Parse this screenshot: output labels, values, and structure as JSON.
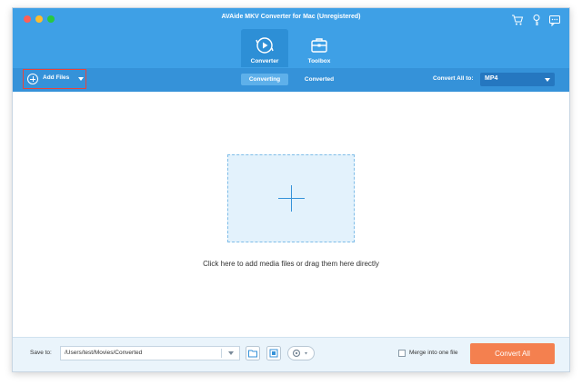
{
  "window": {
    "title": "AVAide MKV Converter for Mac (Unregistered)"
  },
  "top_icons": [
    "cart-icon",
    "key-icon",
    "chat-icon"
  ],
  "nav": {
    "tabs": [
      {
        "label": "Converter",
        "icon": "converter-icon",
        "active": true
      },
      {
        "label": "Toolbox",
        "icon": "toolbox-icon",
        "active": false
      }
    ]
  },
  "toolbar": {
    "add_files_label": "Add Files",
    "segments": [
      {
        "label": "Converting",
        "active": true
      },
      {
        "label": "Converted",
        "active": false
      }
    ],
    "convert_all_to_label": "Convert All to:",
    "format_value": "MP4"
  },
  "main": {
    "drop_hint": "Click here to add media files or drag them here directly"
  },
  "bottom": {
    "save_to_label": "Save to:",
    "save_path": "/Users/test/Movies/Converted",
    "merge_label": "Merge into one file",
    "merge_checked": false,
    "convert_all_label": "Convert All"
  },
  "colors": {
    "titlebar": "#3ea0e6",
    "toolbar": "#3592d9",
    "accent_button": "#f4804f",
    "highlight_border": "#e8453c"
  }
}
